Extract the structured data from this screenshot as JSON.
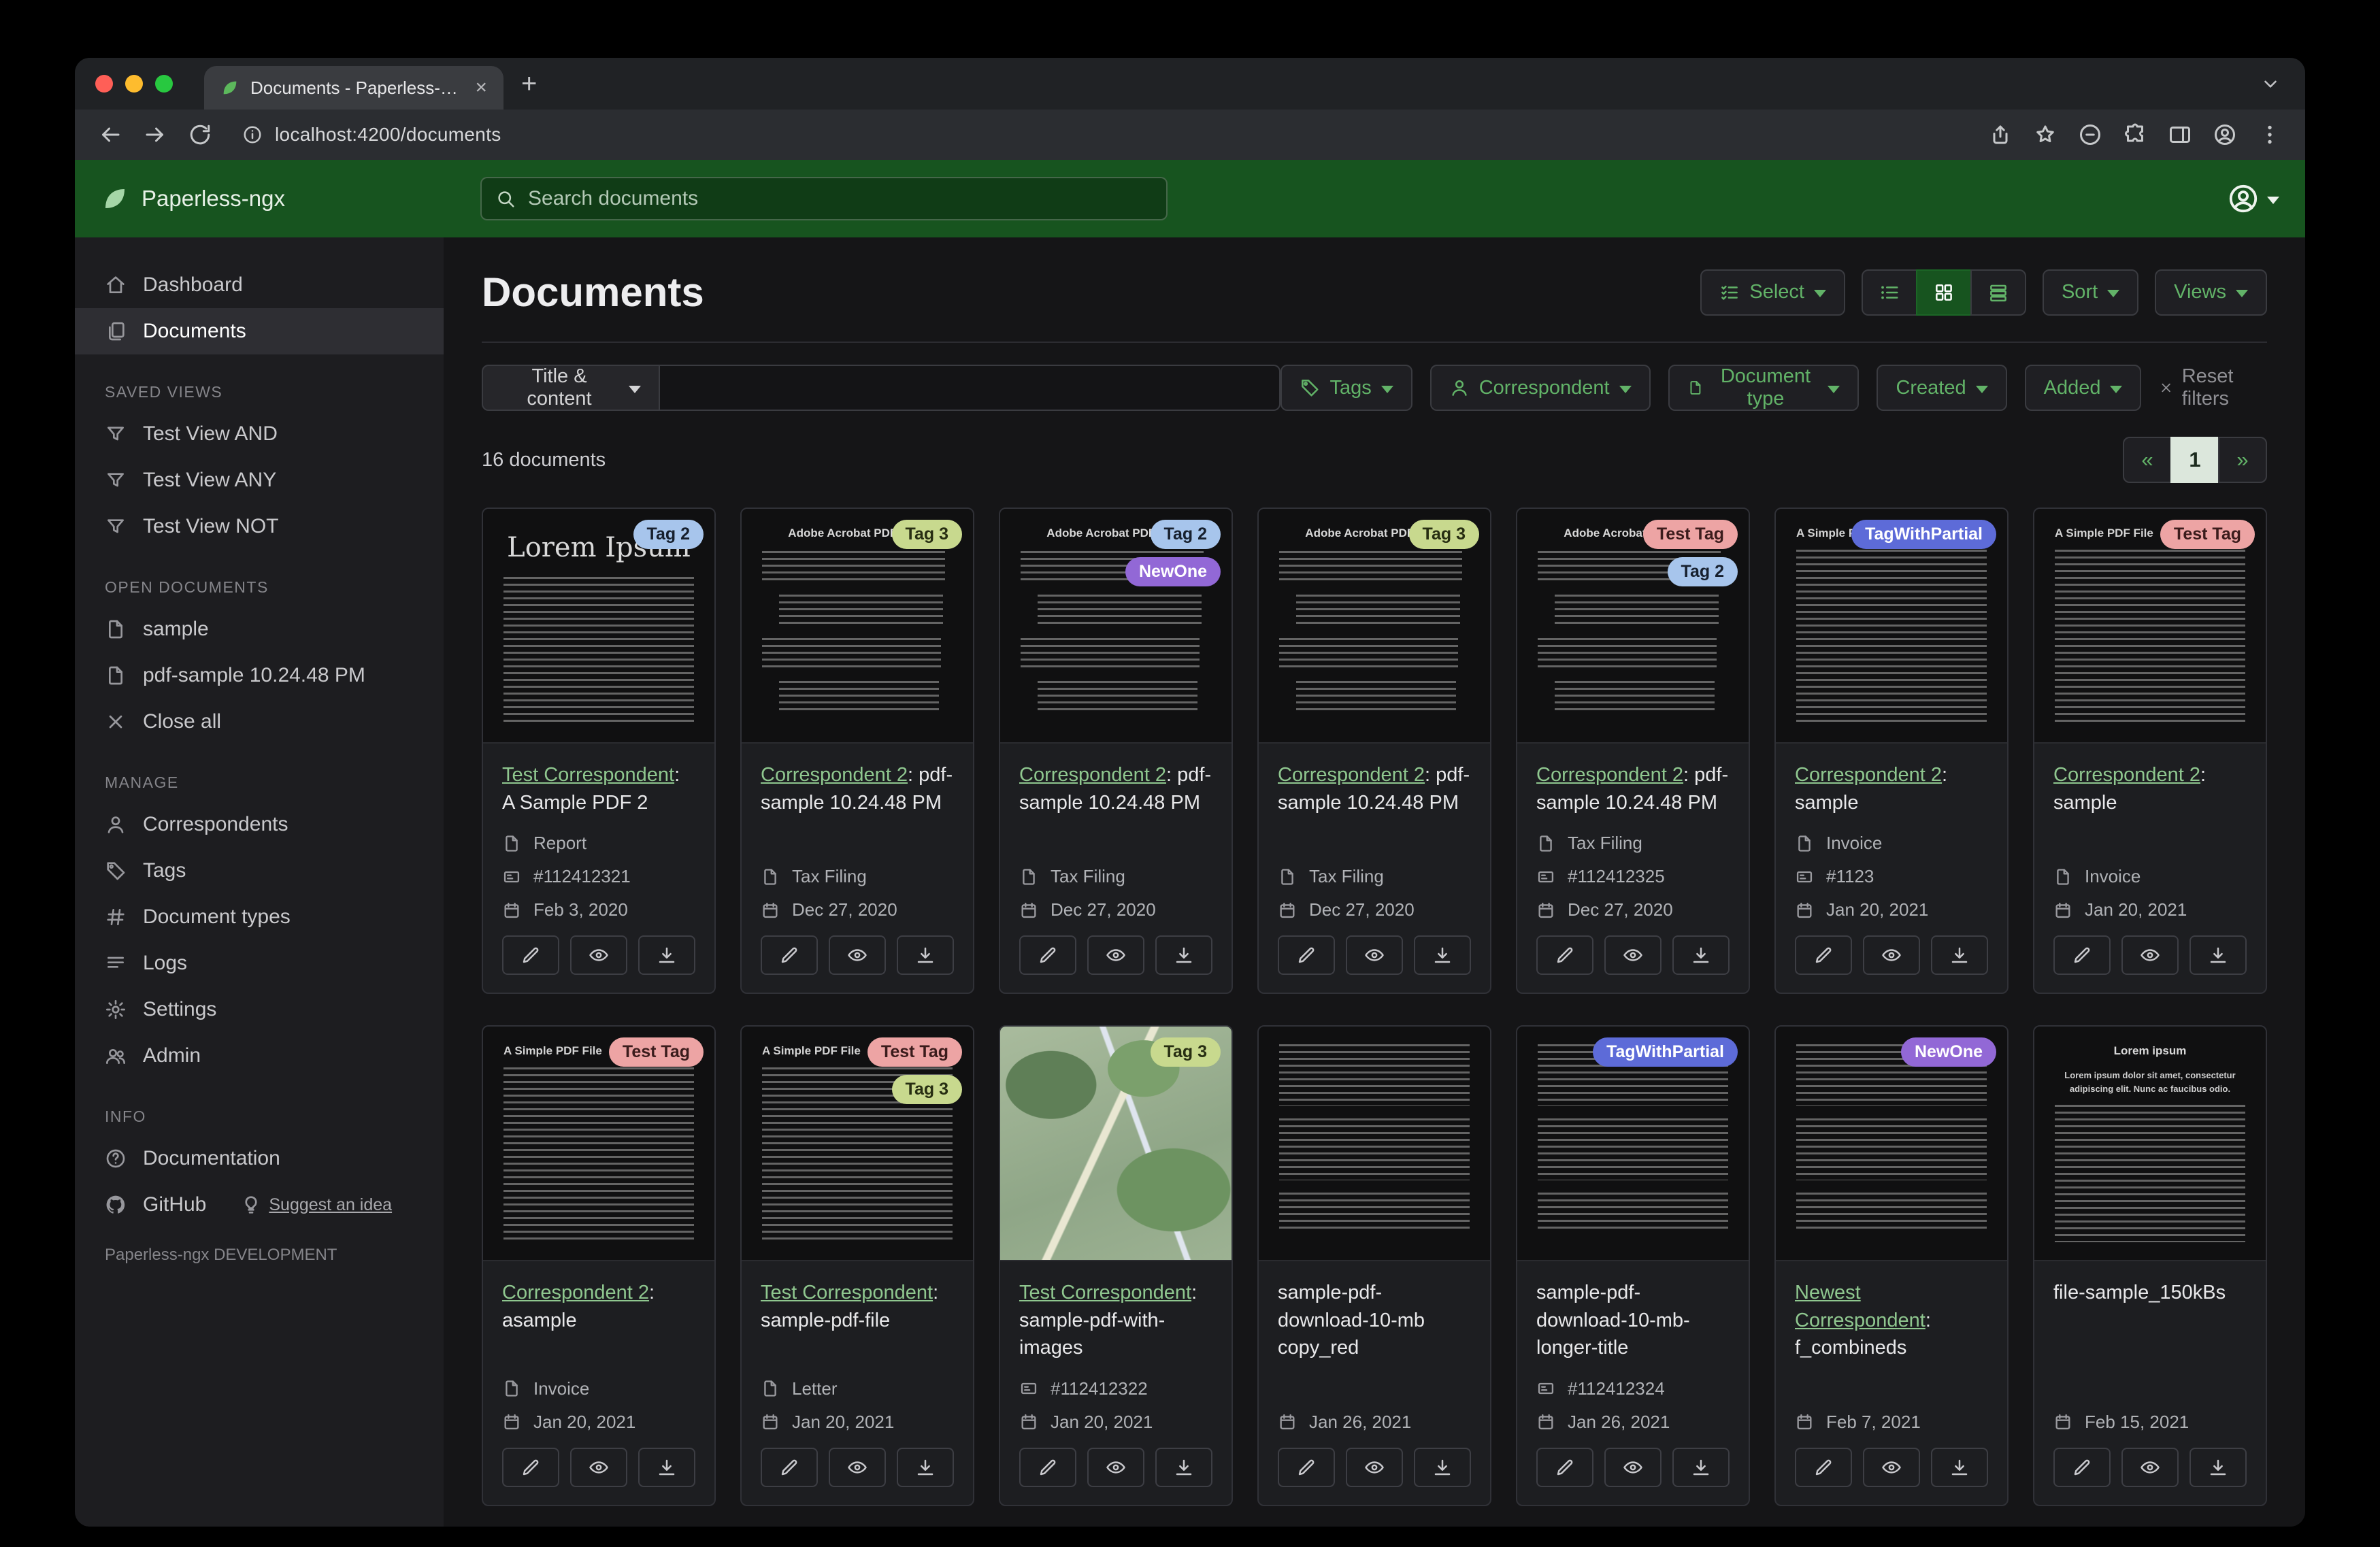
{
  "browser": {
    "tab_title": "Documents - Paperless-ngx",
    "url": "localhost:4200/documents"
  },
  "header": {
    "app_name": "Paperless-ngx",
    "search_placeholder": "Search documents"
  },
  "sidebar": {
    "nav": [
      "Dashboard",
      "Documents"
    ],
    "saved_views_header": "SAVED VIEWS",
    "saved_views": [
      "Test View AND",
      "Test View ANY",
      "Test View NOT"
    ],
    "open_documents_header": "OPEN DOCUMENTS",
    "open_documents": [
      "sample",
      "pdf-sample 10.24.48 PM"
    ],
    "close_all": "Close all",
    "manage_header": "MANAGE",
    "manage": [
      "Correspondents",
      "Tags",
      "Document types",
      "Logs",
      "Settings",
      "Admin"
    ],
    "info_header": "INFO",
    "info": [
      "Documentation",
      "GitHub"
    ],
    "suggest": "Suggest an idea",
    "footer": "Paperless-ngx DEVELOPMENT"
  },
  "main": {
    "title": "Documents",
    "toolbar": {
      "select": "Select",
      "sort": "Sort",
      "views": "Views"
    },
    "filters": {
      "search_type": "Title & content",
      "query": "",
      "tags": "Tags",
      "correspondent": "Correspondent",
      "document_type": "Document type",
      "created": "Created",
      "added": "Added",
      "reset": "Reset filters"
    },
    "count": "16 documents",
    "pagination": {
      "prev": "«",
      "page": "1",
      "next": "»"
    },
    "tag_colors": {
      "Tag 2": {
        "bg": "#a7c5ec",
        "fg": "#17202e"
      },
      "Tag 3": {
        "bg": "#c8d98e",
        "fg": "#272e12"
      },
      "NewOne": {
        "bg": "#9268d6",
        "fg": "#ffffff"
      },
      "Test Tag": {
        "bg": "#eda4a4",
        "fg": "#3b1c1c"
      },
      "TagWithPartial": {
        "bg": "#5d6bd8",
        "fg": "#ffffff"
      }
    },
    "documents": [
      {
        "tags": [
          "Tag 2"
        ],
        "correspondent": "Test Correspondent",
        "title_rest": ": A Sample PDF 2",
        "type": "Report",
        "asn": "#112412321",
        "date": "Feb 3, 2020",
        "thumb": {
          "style": "lorem",
          "heading": "Lorem Ipsum"
        }
      },
      {
        "tags": [
          "Tag 3"
        ],
        "correspondent": "Correspondent 2",
        "title_rest": ": pdf-sample 10.24.48 PM",
        "type": "Tax Filing",
        "asn": "",
        "date": "Dec 27, 2020",
        "thumb": {
          "style": "acrobat",
          "heading": "Adobe Acrobat PDF Files"
        }
      },
      {
        "tags": [
          "Tag 2",
          "NewOne"
        ],
        "correspondent": "Correspondent 2",
        "title_rest": ": pdf-sample 10.24.48 PM",
        "type": "Tax Filing",
        "asn": "",
        "date": "Dec 27, 2020",
        "thumb": {
          "style": "acrobat",
          "heading": "Adobe Acrobat PDF Files"
        }
      },
      {
        "tags": [
          "Tag 3"
        ],
        "correspondent": "Correspondent 2",
        "title_rest": ": pdf-sample 10.24.48 PM",
        "type": "Tax Filing",
        "asn": "",
        "date": "Dec 27, 2020",
        "thumb": {
          "style": "acrobat",
          "heading": "Adobe Acrobat PDF Files"
        }
      },
      {
        "tags": [
          "Test Tag",
          "Tag 2"
        ],
        "correspondent": "Correspondent 2",
        "title_rest": ": pdf-sample 10.24.48 PM",
        "type": "Tax Filing",
        "asn": "#112412325",
        "date": "Dec 27, 2020",
        "thumb": {
          "style": "acrobat",
          "heading": "Adobe Acrobat PDF Files"
        }
      },
      {
        "tags": [
          "TagWithPartial"
        ],
        "correspondent": "Correspondent 2",
        "title_rest": ": sample",
        "type": "Invoice",
        "asn": "#1123",
        "date": "Jan 20, 2021",
        "thumb": {
          "style": "simple",
          "heading": "A Simple PDF File"
        }
      },
      {
        "tags": [
          "Test Tag"
        ],
        "correspondent": "Correspondent 2",
        "title_rest": ": sample",
        "type": "Invoice",
        "asn": "",
        "date": "Jan 20, 2021",
        "thumb": {
          "style": "simple",
          "heading": "A Simple PDF File"
        }
      },
      {
        "tags": [
          "Test Tag"
        ],
        "correspondent": "Correspondent 2",
        "title_rest": ": asample",
        "type": "Invoice",
        "asn": "",
        "date": "Jan 20, 2021",
        "thumb": {
          "style": "simple",
          "heading": "A Simple PDF File"
        }
      },
      {
        "tags": [
          "Test Tag",
          "Tag 3"
        ],
        "correspondent": "Test Correspondent",
        "title_rest": ": sample-pdf-file",
        "type": "Letter",
        "asn": "",
        "date": "Jan 20, 2021",
        "thumb": {
          "style": "simple",
          "heading": "A Simple PDF File"
        }
      },
      {
        "tags": [
          "Tag 3"
        ],
        "correspondent": "Test Correspondent",
        "title_rest": ": sample-pdf-with-images",
        "type": "",
        "asn": "#112412322",
        "date": "Jan 20, 2021",
        "thumb": {
          "style": "map",
          "heading": ""
        }
      },
      {
        "tags": [],
        "correspondent": "",
        "title_rest": "sample-pdf-download-10-mb copy_red",
        "type": "",
        "asn": "",
        "date": "Jan 26, 2021",
        "thumb": {
          "style": "text",
          "heading": ""
        }
      },
      {
        "tags": [
          "TagWithPartial"
        ],
        "correspondent": "",
        "title_rest": "sample-pdf-download-10-mb-longer-title",
        "type": "",
        "asn": "#112412324",
        "date": "Jan 26, 2021",
        "thumb": {
          "style": "text",
          "heading": ""
        }
      },
      {
        "tags": [
          "NewOne"
        ],
        "correspondent": "Newest Correspondent",
        "title_rest": ": f_combineds",
        "type": "",
        "asn": "",
        "date": "Feb 7, 2021",
        "thumb": {
          "style": "text",
          "heading": ""
        }
      },
      {
        "tags": [],
        "correspondent": "",
        "title_rest": "file-sample_150kBs",
        "type": "",
        "asn": "",
        "date": "Feb 15, 2021",
        "thumb": {
          "style": "lorem2",
          "heading": "Lorem ipsum",
          "sub": "Lorem ipsum dolor sit amet, consectetur adipiscing elit. Nunc ac faucibus odio."
        }
      }
    ]
  },
  "icons": {
    "app-logo": "leaf",
    "search": "magnifier",
    "user-menu": "person-circle",
    "saved-view": "funnel",
    "open-document": "file-text",
    "edit": "pencil",
    "preview": "eye",
    "download": "arrow-down-to-line",
    "document-type": "file-text",
    "archive-serial-number": "id-card",
    "date": "calendar"
  }
}
